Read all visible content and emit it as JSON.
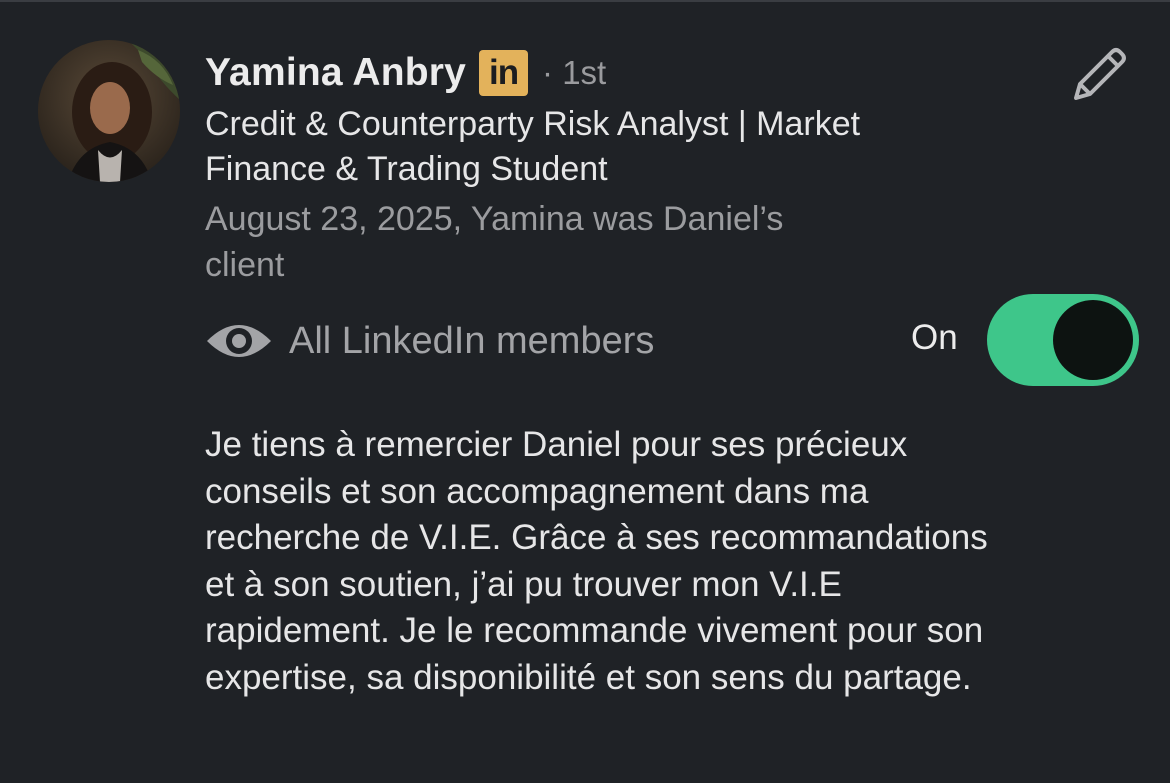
{
  "recommendation": {
    "name": "Yamina Anbry",
    "badge": "in",
    "degree": "· 1st",
    "headline": "Credit & Counterparty Risk Analyst | Market Finance & Trading Student",
    "relation": "August 23, 2025, Yamina was Daniel’s client",
    "edit_icon": "pencil-icon",
    "avatar": "profile-photo",
    "visibility": {
      "icon": "eye-icon",
      "label": "All LinkedIn members",
      "toggle_label": "On",
      "toggle_on": true,
      "toggle_color": "#3ec68a"
    },
    "text": "Je tiens à remercier Daniel pour ses précieux\nconseils et son accompagnement dans ma\nrecherche de V.I.E. Grâce à ses recommandations\net à son soutien, j’ai pu trouver mon V.I.E\nrapidement. Je le recommande vivement pour son\nexpertise, sa disponibilité et son sens du partage."
  },
  "colors": {
    "background": "#1f2226",
    "badge": "#e3b25b",
    "primary_text": "#e9e9ea",
    "secondary_text": "#9b9c9f"
  }
}
